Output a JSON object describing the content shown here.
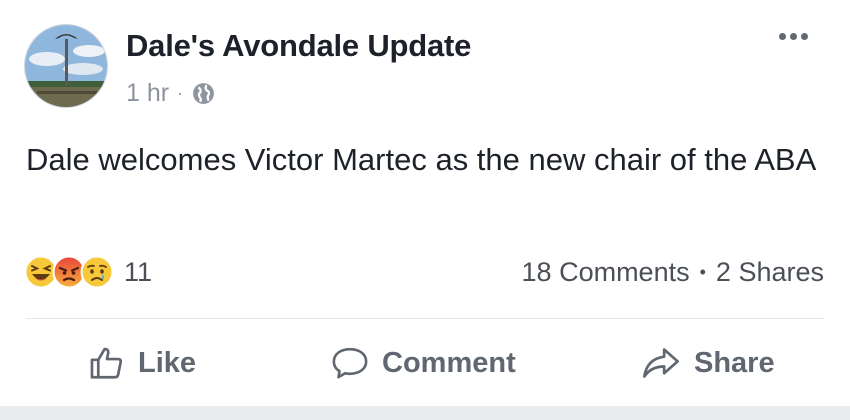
{
  "post": {
    "page_name": "Dale's Avondale Update",
    "time": "1 hr",
    "meta_separator": "·",
    "privacy_icon": "globe-icon",
    "more_icon": "more-options-icon",
    "text": "Dale welcomes Victor Martec as the new chair of the ABA"
  },
  "reactions": {
    "icons": [
      "haha-icon",
      "angry-icon",
      "sad-icon"
    ],
    "count": "11"
  },
  "counts": {
    "comments": "18 Comments",
    "separator": "•",
    "shares": "2 Shares"
  },
  "actions": {
    "like_label": "Like",
    "comment_label": "Comment",
    "share_label": "Share"
  },
  "colors": {
    "text_primary": "#1d2129",
    "text_secondary": "#606770",
    "meta": "#8d949e",
    "divider": "#e4e6eb",
    "reaction_yellow": "#f7c83a",
    "reaction_angry": "#e9713b"
  }
}
